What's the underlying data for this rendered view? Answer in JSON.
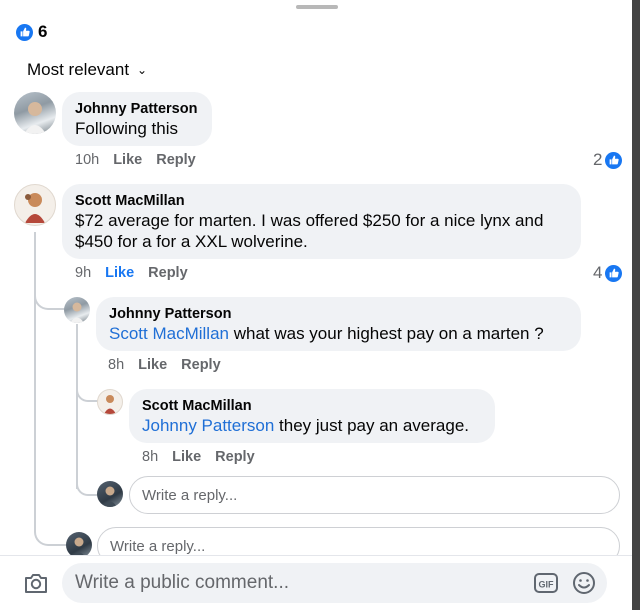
{
  "reactions": {
    "count": "6",
    "icon": "like-icon",
    "color": "#1877f2"
  },
  "sort": {
    "label": "Most relevant",
    "chevron": "chevron-down-icon"
  },
  "comments": [
    {
      "author": "Johnny Patterson",
      "text": "Following this",
      "time": "10h",
      "like": "Like",
      "reply": "Reply",
      "likes": "2"
    },
    {
      "author": "Scott MacMillan",
      "text_line1": "$72 average for marten. I was offered $250 for a nice lynx and",
      "text_line2": "$450 for a for a XXL wolverine.",
      "time": "9h",
      "like": "Like",
      "reply": "Reply",
      "likes": "4",
      "liked": true,
      "replies": [
        {
          "author": "Johnny Patterson",
          "mention": "Scott MacMillan",
          "text": " what was your highest pay on a marten ?",
          "time": "8h",
          "like": "Like",
          "reply": "Reply"
        },
        {
          "author": "Scott MacMillan",
          "mention": "Johnny Patterson",
          "text": " they just pay an average.",
          "time": "8h",
          "like": "Like",
          "reply": "Reply"
        }
      ]
    }
  ],
  "reply_placeholder": "Write a reply...",
  "composer": {
    "placeholder": "Write a public comment...",
    "gif": "GIF"
  }
}
